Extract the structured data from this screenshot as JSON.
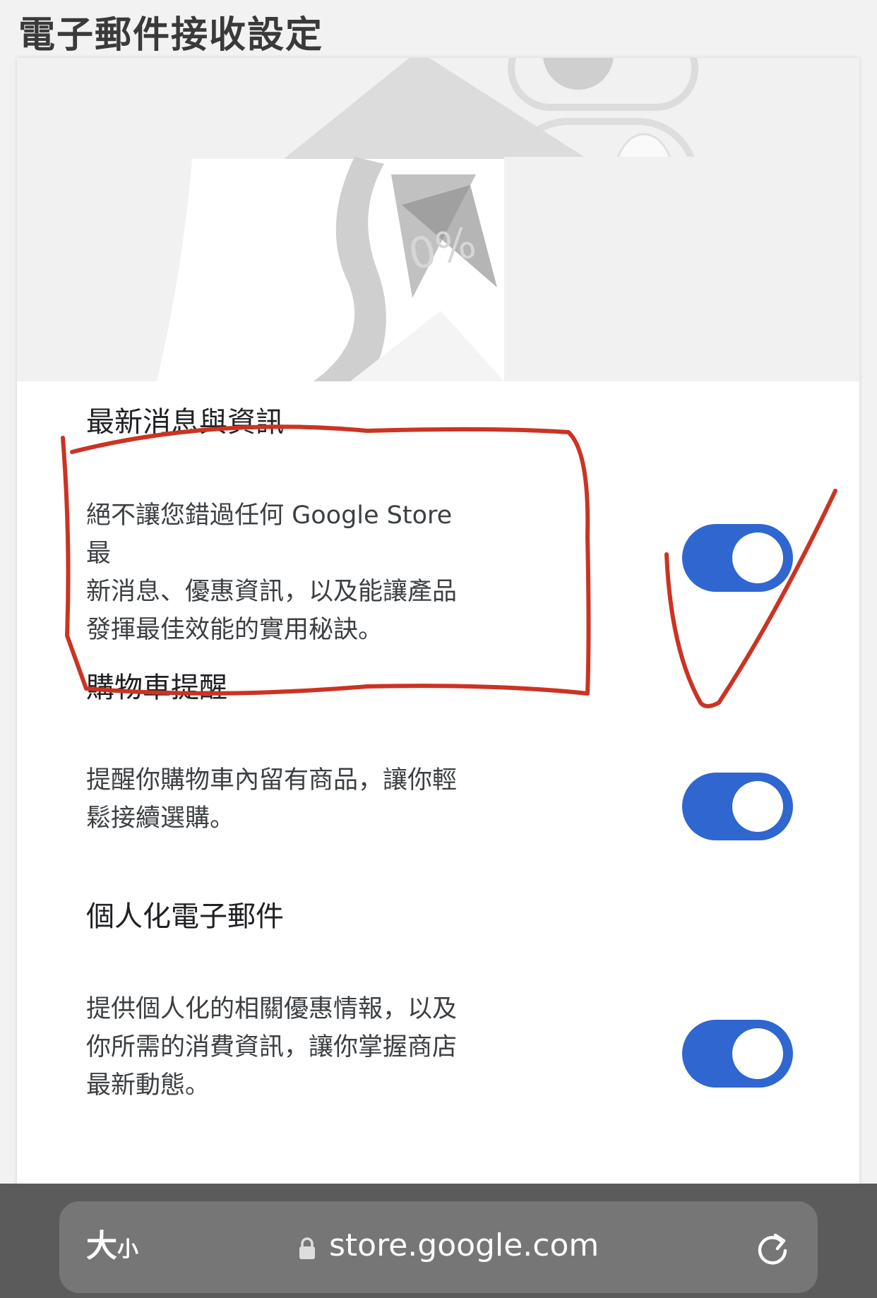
{
  "page": {
    "title": "電子郵件接收設定"
  },
  "preferences": [
    {
      "title": "最新消息與資訊",
      "lines": [
        "絕不讓您錯過任何 Google Store 最",
        "新消息、優惠資訊，以及能讓產品",
        "發揮最佳效能的實用秘訣。"
      ],
      "enabled": true
    },
    {
      "title": "購物車提醒",
      "lines": [
        "提醒你購物車內留有商品，讓你輕",
        "鬆接續選購。"
      ],
      "enabled": true
    },
    {
      "title": "個人化電子郵件",
      "lines": [
        "提供個人化的相關優惠情報，以及",
        "你所需的消費資訊，讓你掌握商店",
        "最新動態。"
      ],
      "enabled": true
    }
  ],
  "hero": {
    "badge_text": "0%"
  },
  "browser_bar": {
    "text_size_large": "大",
    "text_size_small": "小",
    "url": "store.google.com",
    "icons": [
      "lock-icon",
      "reload-icon"
    ]
  },
  "colors": {
    "toggle_on": "#2f66d0",
    "annotation": "#cc3322",
    "bottom_bar": "#5b5b5b",
    "url_pill": "#767676"
  },
  "annotation": {
    "type": "hand-drawn red rectangle and check mark"
  }
}
